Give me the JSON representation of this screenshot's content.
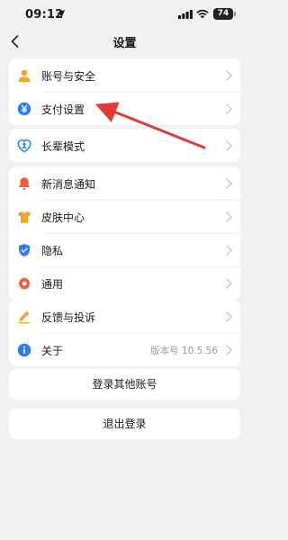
{
  "status_bar": {
    "time": "09:12",
    "battery": "74"
  },
  "nav": {
    "title": "设置"
  },
  "groups": [
    {
      "items": [
        {
          "label": "账号与安全",
          "icon": "account-icon",
          "color": "#f5a623"
        },
        {
          "label": "支付设置",
          "icon": "payment-icon",
          "color": "#2f7cf6"
        }
      ]
    },
    {
      "items": [
        {
          "label": "长辈模式",
          "icon": "elder-mode-icon",
          "color": "#2f7cf6"
        }
      ]
    },
    {
      "items": [
        {
          "label": "新消息通知",
          "icon": "bell-icon",
          "color": "#f45b3b"
        },
        {
          "label": "皮肤中心",
          "icon": "tshirt-icon",
          "color": "#f5a623"
        },
        {
          "label": "隐私",
          "icon": "shield-icon",
          "color": "#2f7cf6"
        },
        {
          "label": "通用",
          "icon": "gear-icon",
          "color": "#f45b3b"
        }
      ]
    },
    {
      "items": [
        {
          "label": "反馈与投诉",
          "icon": "feedback-pencil-icon",
          "color": "#f5a623"
        },
        {
          "label": "关于",
          "icon": "info-icon",
          "color": "#2f7cf6",
          "value": "版本号 10.5.56"
        }
      ]
    }
  ],
  "actions": {
    "login_other": "登录其他账号",
    "logout": "退出登录"
  },
  "annotation": {
    "color": "#e53935"
  }
}
